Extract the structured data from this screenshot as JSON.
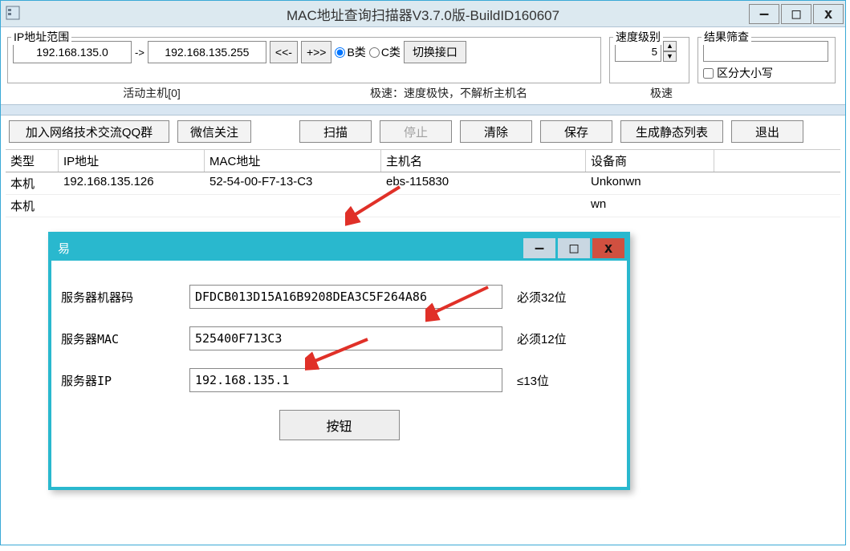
{
  "main": {
    "title": "MAC地址查询扫描器V3.7.0版-BuildID160607",
    "iprange_label": "IP地址范围",
    "ip_start": "192.168.135.0",
    "arrow": "->",
    "ip_end": "192.168.135.255",
    "btn_dec": "<<-",
    "btn_inc": "+>>",
    "radio_b": "B类",
    "radio_c": "C类",
    "btn_switch_if": "切换接口",
    "speed_label": "速度级别",
    "speed_value": "5",
    "filter_label": "结果筛查",
    "filter_value": "",
    "status_hosts": "活动主机[0]",
    "status_speed": "极速：速度极快，不解析主机名",
    "status_speed_short": "极速",
    "case_sensitive": "区分大小写"
  },
  "buttons": {
    "join_qq": "加入网络技术交流QQ群",
    "wechat": "微信关注",
    "scan": "扫描",
    "stop": "停止",
    "clear": "清除",
    "save": "保存",
    "gen_static": "生成静态列表",
    "exit": "退出"
  },
  "table": {
    "headers": [
      "类型",
      "IP地址",
      "MAC地址",
      "主机名",
      "设备商"
    ],
    "rows": [
      [
        "本机",
        "192.168.135.126",
        "52-54-00-F7-13-C3",
        "ebs-115830",
        "Unkonwn"
      ],
      [
        "本机",
        "",
        "",
        "",
        "wn"
      ]
    ]
  },
  "dialog": {
    "title": "易",
    "rows": [
      {
        "label": "服务器机器码",
        "value": "DFDCB013D15A16B9208DEA3C5F264A86",
        "hint": "必须32位"
      },
      {
        "label": "服务器MAC",
        "value": "525400F713C3",
        "hint": "必须12位"
      },
      {
        "label": "服务器IP",
        "value": "192.168.135.1",
        "hint": "≤13位"
      }
    ],
    "button": "按钮"
  }
}
